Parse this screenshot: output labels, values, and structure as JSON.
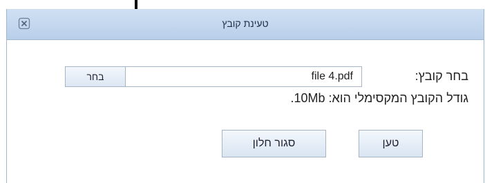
{
  "dialog": {
    "title": "טעינת קובץ",
    "close_icon": "close-x-icon"
  },
  "form": {
    "file_label": "בחר קובץ:",
    "file_value": "file 4.pdf",
    "browse_label": "בחר",
    "max_size_text": "גודל הקובץ המקסימלי הוא: 10Mb."
  },
  "buttons": {
    "load_label": "טען",
    "close_window_label": "סגור חלון"
  },
  "annotation": {
    "arrow_icon": "down-arrow-icon"
  }
}
